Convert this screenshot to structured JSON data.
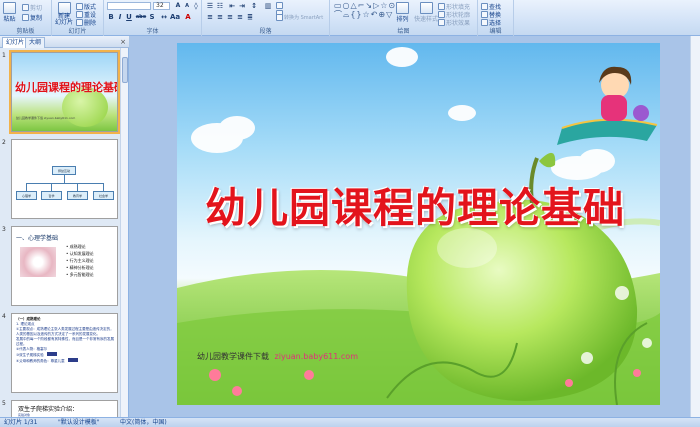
{
  "ribbon": {
    "clipboard": {
      "paste": "粘贴",
      "cut": "剪切",
      "copy": "复制",
      "label": "剪贴板"
    },
    "slides": {
      "new_slide": "新建\n幻灯片",
      "layout": "版式",
      "reset": "重设",
      "delete": "删除",
      "label": "幻灯片"
    },
    "font": {
      "size": "32",
      "label": "字体",
      "bold": "B",
      "italic": "I",
      "underline": "U",
      "strike": "abe",
      "shadow": "S"
    },
    "paragraph": {
      "convert_smartart": "转换为 SmartArt",
      "label": "段落"
    },
    "drawing": {
      "arrange": "排列",
      "quick_styles": "快速样式",
      "shape_fill": "形状填充",
      "shape_outline": "形状轮廓",
      "shape_effects": "形状效果",
      "label": "绘图"
    },
    "editing": {
      "find": "查找",
      "replace": "替换",
      "select": "选择",
      "label": "编辑"
    }
  },
  "left_pane": {
    "tabs": [
      "幻灯片",
      "大纲"
    ],
    "close": "×",
    "slides": [
      {
        "num": "1",
        "title": "幼儿园课程的理论基础",
        "footer": "幼儿园教学课件下载  ziyuan.baby611.com"
      },
      {
        "num": "2",
        "root": "师幼互动",
        "children": [
          "心理学",
          "哲学",
          "教育学",
          "社会学"
        ]
      },
      {
        "num": "3",
        "title": "一、心理学基础",
        "items": [
          "成熟理论",
          "认知发展理论",
          "行为主义理论",
          "精神分析理论",
          "多元智能理论"
        ]
      },
      {
        "num": "4",
        "lines": [
          "（一）成熟理论",
          "1. 理论观点",
          "①主要观点：成熟理论主张人类发展过程主要是由遗传决定的，人类的基因以及遗传的方式决定了一系列的发展变化。",
          "发展中的每一个阶段都有其特殊性，而且是一个非常有序的发展过程。",
          "②代表人物：格塞尔",
          "③双生子爬梯实验",
          "④父母和教师的角色：尊重儿童"
        ]
      },
      {
        "num": "5",
        "title": "双生子爬梯实验介绍：",
        "text": "实验对象"
      }
    ]
  },
  "slide": {
    "title": "幼儿园课程的理论基础",
    "footer_label": "幼儿园教学课件下载",
    "footer_url": "ziyuan.baby611.com"
  },
  "status": {
    "slide_info": "幻灯片 1/31",
    "theme": "\"默认设计模板\"",
    "language": "中文(简体，中国)"
  }
}
